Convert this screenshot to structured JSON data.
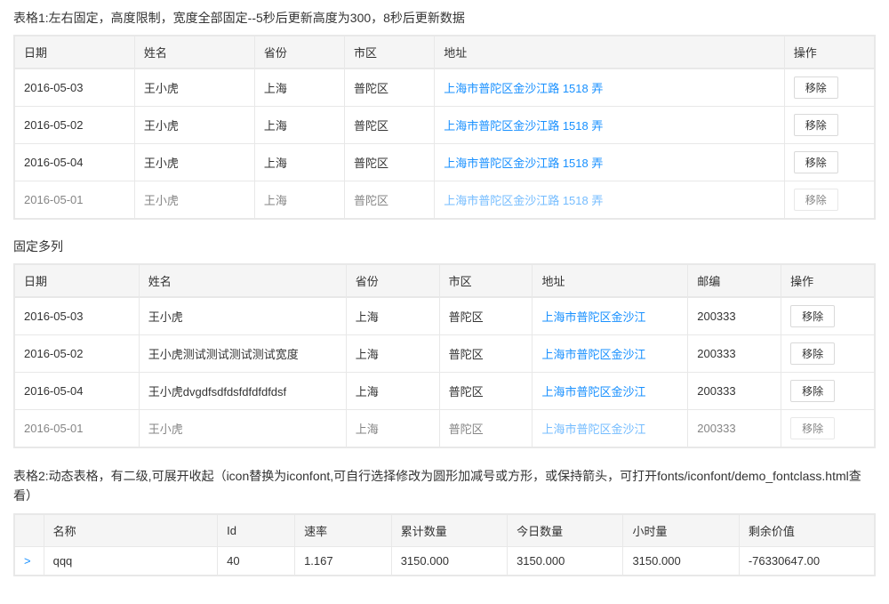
{
  "table1": {
    "title": "表格1:左右固定，高度限制，宽度全部固定--5秒后更新高度为300，8秒后更新数据",
    "columns": [
      "日期",
      "姓名",
      "省份",
      "市区",
      "地址",
      "操作"
    ],
    "rows": [
      {
        "date": "2016-05-03",
        "name": "王小虎",
        "province": "上海",
        "city": "普陀区",
        "address": "上海市普陀区金沙江路 1518 弄",
        "action": "移除"
      },
      {
        "date": "2016-05-02",
        "name": "王小虎",
        "province": "上海",
        "city": "普陀区",
        "address": "上海市普陀区金沙江路 1518 弄",
        "action": "移除"
      },
      {
        "date": "2016-05-04",
        "name": "王小虎",
        "province": "上海",
        "city": "普陀区",
        "address": "上海市普陀区金沙江路 1518 弄",
        "action": "移除"
      },
      {
        "date": "2016-05-01",
        "name": "王小虎",
        "province": "上海",
        "city": "普陀区",
        "address": "上海市普陀区金沙江路 1518 弄",
        "action": "移除"
      }
    ]
  },
  "table2_section": {
    "title": "固定多列"
  },
  "table2": {
    "columns": [
      "日期",
      "姓名",
      "省份",
      "市区",
      "地址",
      "邮编",
      "操作"
    ],
    "rows": [
      {
        "date": "2016-05-03",
        "name": "王小虎",
        "province": "上海",
        "city": "普陀区",
        "address": "上海市普陀区金沙江",
        "postcode": "200333",
        "action": "移除"
      },
      {
        "date": "2016-05-02",
        "name": "王小虎测试测试测试测试宽度",
        "province": "上海",
        "city": "普陀区",
        "address": "上海市普陀区金沙江",
        "postcode": "200333",
        "action": "移除"
      },
      {
        "date": "2016-05-04",
        "name": "王小虎dvgdfsdfdsfdfdfdfdsf",
        "province": "上海",
        "city": "普陀区",
        "address": "上海市普陀区金沙江",
        "postcode": "200333",
        "action": "移除"
      },
      {
        "date": "2016-05-01",
        "name": "王小虎",
        "province": "上海",
        "city": "普陀区",
        "address": "上海市普陀区金沙江",
        "postcode": "200333",
        "action": "移除"
      }
    ]
  },
  "table3_section": {
    "title": "表格2:动态表格，有二级,可展开收起（icon替换为iconfont,可自行选择修改为圆形加减号或方形，或保持箭头，可打开fonts/iconfont/demo_fontclass.html查看）",
    "columns": [
      "名称",
      "Id",
      "速率",
      "累计数量",
      "今日数量",
      "小时量",
      "剩余价值"
    ],
    "rows": [
      {
        "expand": ">",
        "name": "qqq",
        "id": "40",
        "speed": "1.167",
        "total": "3150.000",
        "today": "3150.000",
        "hours": "3150.000",
        "remain": "-76330647.00"
      }
    ]
  }
}
